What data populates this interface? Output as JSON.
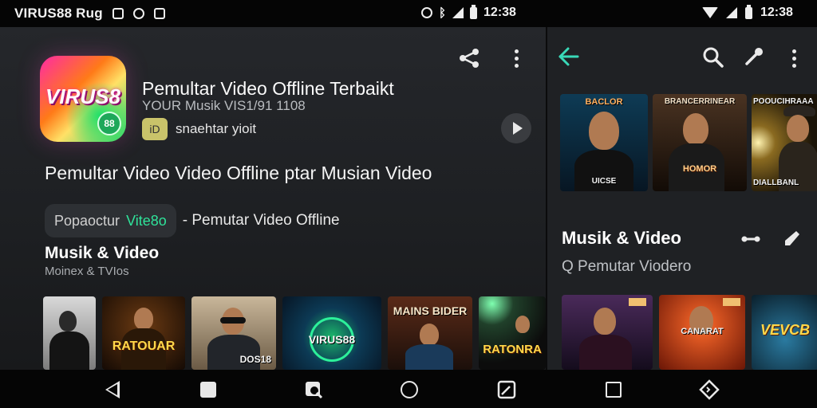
{
  "status_bar": {
    "app_label": "VIRUS88 Rug",
    "time_left": "12:38",
    "time_right": "12:38"
  },
  "app": {
    "icon_text": "VIRUS8",
    "icon_badge": "88",
    "title": "Pemultar Video Offline Terbaikt",
    "subtitle": "YOUR Musik  VIS1/91 1108",
    "developer_badge": "iD",
    "developer": "snaehtar yioit"
  },
  "headline": "Pemultar Video Video Offline ptar Musian Video",
  "chip": {
    "prefix": "Popaoctur",
    "accent": "Vite8o",
    "suffix": "- Pemutar Video Offline"
  },
  "left_section": {
    "title": "Musik & Video",
    "subtitle": "Moinex & TVIos",
    "thumbs": [
      "",
      "RATOUAR",
      "DOS18",
      "VIRUS88",
      "MAINS BIDER",
      "RATONRA"
    ]
  },
  "right_section": {
    "top_thumbs": [
      {
        "top": "BACLOR",
        "bottom": "UICSE"
      },
      {
        "top": "BRANCERRINEAR",
        "bottom": "HOMOR"
      },
      {
        "top": "POOUCIHRAAA",
        "bottom": "DIALLBANL"
      }
    ],
    "title": "Musik & Video",
    "subtitle": "Q Pemutar Viodero",
    "bottom_thumbs": [
      "",
      "CANARAT",
      "VEVCB"
    ]
  },
  "colors": {
    "accent": "#2fe39a",
    "back_arrow": "#39d9b8",
    "background": "#1f2124"
  }
}
